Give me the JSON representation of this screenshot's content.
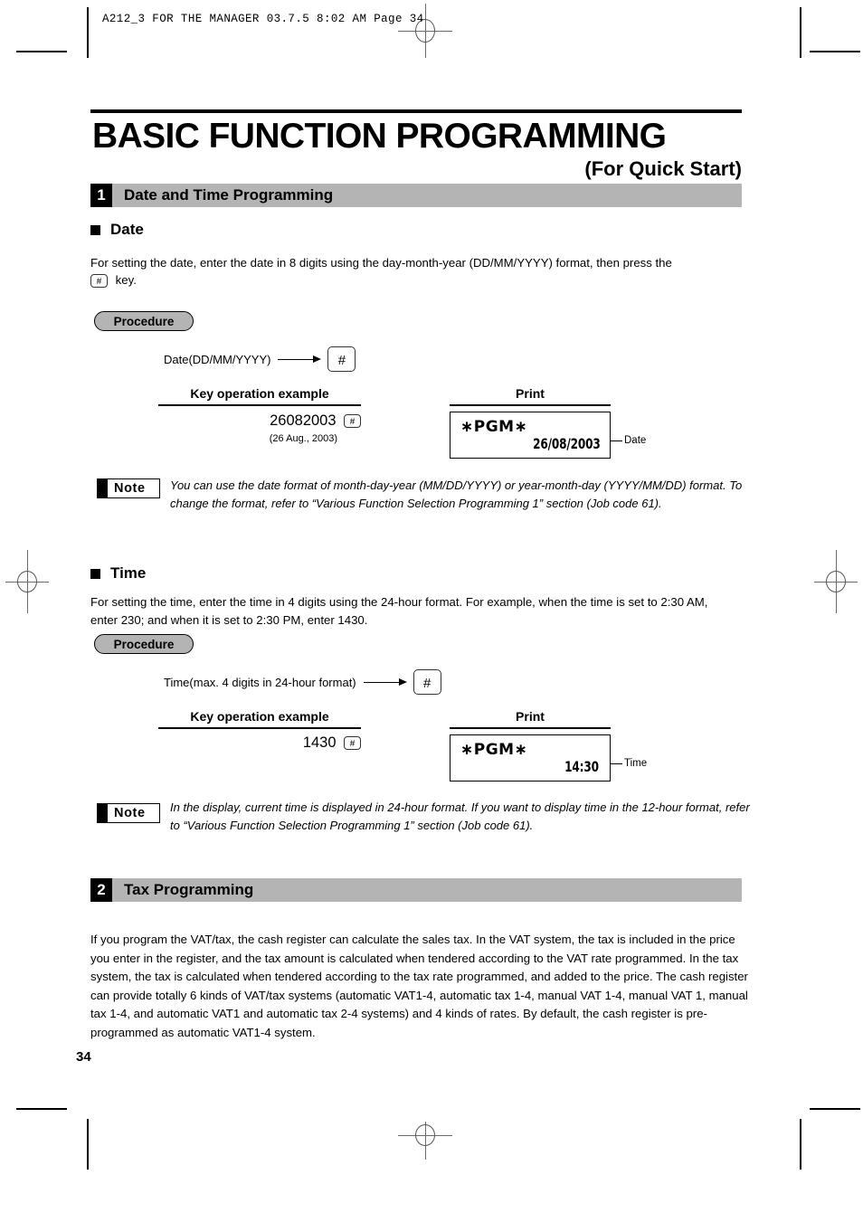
{
  "running_head": "A212_3 FOR THE MANAGER  03.7.5 8:02 AM  Page 34",
  "title": {
    "main": "BASIC FUNCTION PROGRAMMING",
    "subtitle": "(For Quick Start)"
  },
  "sections": [
    {
      "number": "1",
      "heading": "Date and Time Programming"
    },
    {
      "number": "2",
      "heading": "Tax Programming",
      "body": "If you program the VAT/tax, the cash register can calculate the sales tax.  In the VAT system, the tax is included in the price you enter in the register, and the tax amount is calculated when tendered according to the VAT rate programmed.  In the tax system, the tax is calculated when tendered according to the tax rate programmed, and added to the price. The cash register can provide totally 6 kinds of VAT/tax systems (automatic VAT1-4, automatic tax 1-4, manual VAT 1-4, manual VAT 1, manual tax 1-4, and automatic VAT1 and automatic tax 2-4 systems) and 4 kinds of rates.  By default, the cash register is pre-programmed as automatic VAT1-4 system."
    }
  ],
  "date_block": {
    "heading": "Date",
    "intro_line1": "For setting the date, enter the date in 8 digits using the day-month-year (DD/MM/YYYY) format, then press the",
    "intro_line2": "key.",
    "key_glyph": "#",
    "procedure_label": "Procedure",
    "flow_label": "Date(DD/MM/YYYY)",
    "flow_key": "#",
    "col_keyop": "Key operation example",
    "col_print": "Print",
    "keyop_digits": "26082003",
    "keyop_key": "#",
    "keyop_note": "(26 Aug., 2003)",
    "print_header": "∗PGM∗",
    "print_value": "26/08/2003",
    "callout": "Date",
    "note_label": "Note",
    "note_text": "You can use the date format of month-day-year (MM/DD/YYYY) or year-month-day (YYYY/MM/DD) format.  To change the format, refer to “Various Function Selection Programming 1” section (Job code 61)."
  },
  "time_block": {
    "heading": "Time",
    "intro": "For setting the time, enter the time in 4 digits using the 24-hour format.  For example, when the time is set to 2:30 AM, enter 230; and when it is set to 2:30 PM, enter 1430.",
    "procedure_label": "Procedure",
    "flow_label": "Time(max. 4 digits in 24-hour format)",
    "flow_key": "#",
    "col_keyop": "Key operation example",
    "col_print": "Print",
    "keyop_digits": "1430",
    "keyop_key": "#",
    "print_header": "∗PGM∗",
    "print_value": "14:30",
    "callout": "Time",
    "note_label": "Note",
    "note_text": "In the display, current time is displayed in 24-hour format.  If you want to display time in the 12-hour format, refer to “Various Function Selection Programming 1” section (Job code 61)."
  },
  "folio": "34"
}
